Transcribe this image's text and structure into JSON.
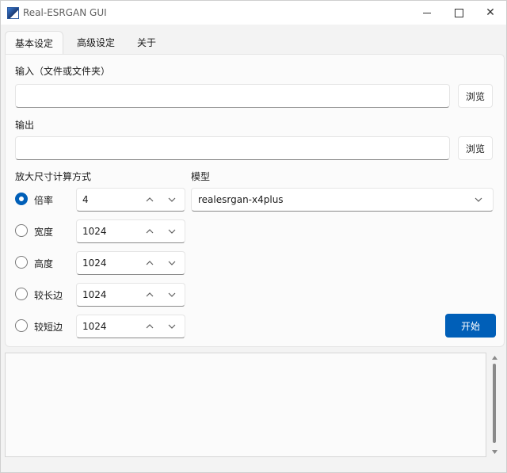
{
  "window": {
    "title": "Real-ESRGAN GUI",
    "icon": "app-icon",
    "controls": [
      "minimize-icon",
      "maximize-icon",
      "close-icon"
    ]
  },
  "tabs": [
    {
      "label": "基本设定",
      "active": true
    },
    {
      "label": "高级设定",
      "active": false
    },
    {
      "label": "关于",
      "active": false
    }
  ],
  "input": {
    "label": "输入（文件或文件夹）",
    "value": "",
    "browse_label": "浏览"
  },
  "output": {
    "label": "输出",
    "value": "",
    "browse_label": "浏览"
  },
  "scale": {
    "label": "放大尺寸计算方式",
    "options": [
      {
        "label": "倍率",
        "value": "4",
        "checked": true
      },
      {
        "label": "宽度",
        "value": "1024",
        "checked": false
      },
      {
        "label": "高度",
        "value": "1024",
        "checked": false
      },
      {
        "label": "较长边",
        "value": "1024",
        "checked": false
      },
      {
        "label": "较短边",
        "value": "1024",
        "checked": false
      }
    ]
  },
  "model": {
    "label": "模型",
    "selected": "realesrgan-x4plus"
  },
  "start_label": "开始",
  "log_text": "",
  "colors": {
    "accent": "#005fb8",
    "background": "#f3f3f3",
    "panel": "#fbfbfb"
  }
}
